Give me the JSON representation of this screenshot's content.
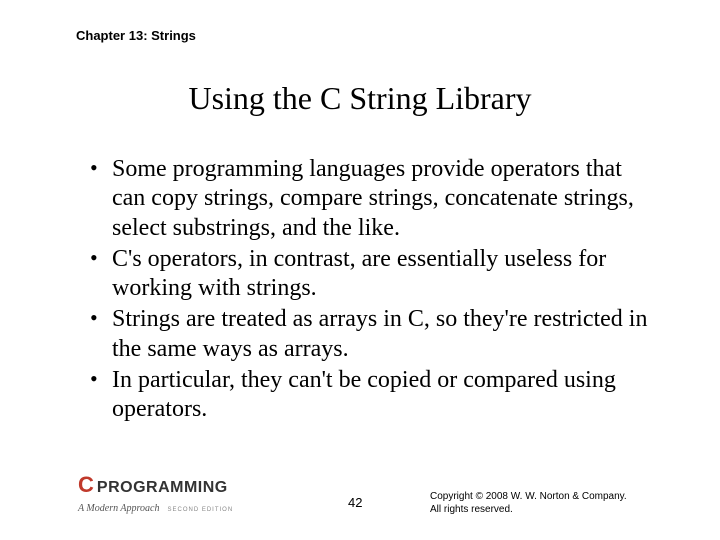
{
  "header": {
    "chapter": "Chapter 13: Strings"
  },
  "title": "Using the C String Library",
  "bullets": [
    "Some programming languages provide operators that can copy strings, compare strings, concatenate strings, select substrings, and the like.",
    "C's operators, in contrast, are essentially useless for working with strings.",
    "Strings are treated as arrays in C, so they're restricted in the same ways as arrays.",
    "In particular, they can't be copied or compared using operators."
  ],
  "footer": {
    "logo_c": "C",
    "logo_text": "PROGRAMMING",
    "logo_subtitle": "A Modern Approach",
    "logo_edition": "SECOND EDITION",
    "page_number": "42",
    "copyright_line1": "Copyright © 2008 W. W. Norton & Company.",
    "copyright_line2": "All rights reserved."
  }
}
